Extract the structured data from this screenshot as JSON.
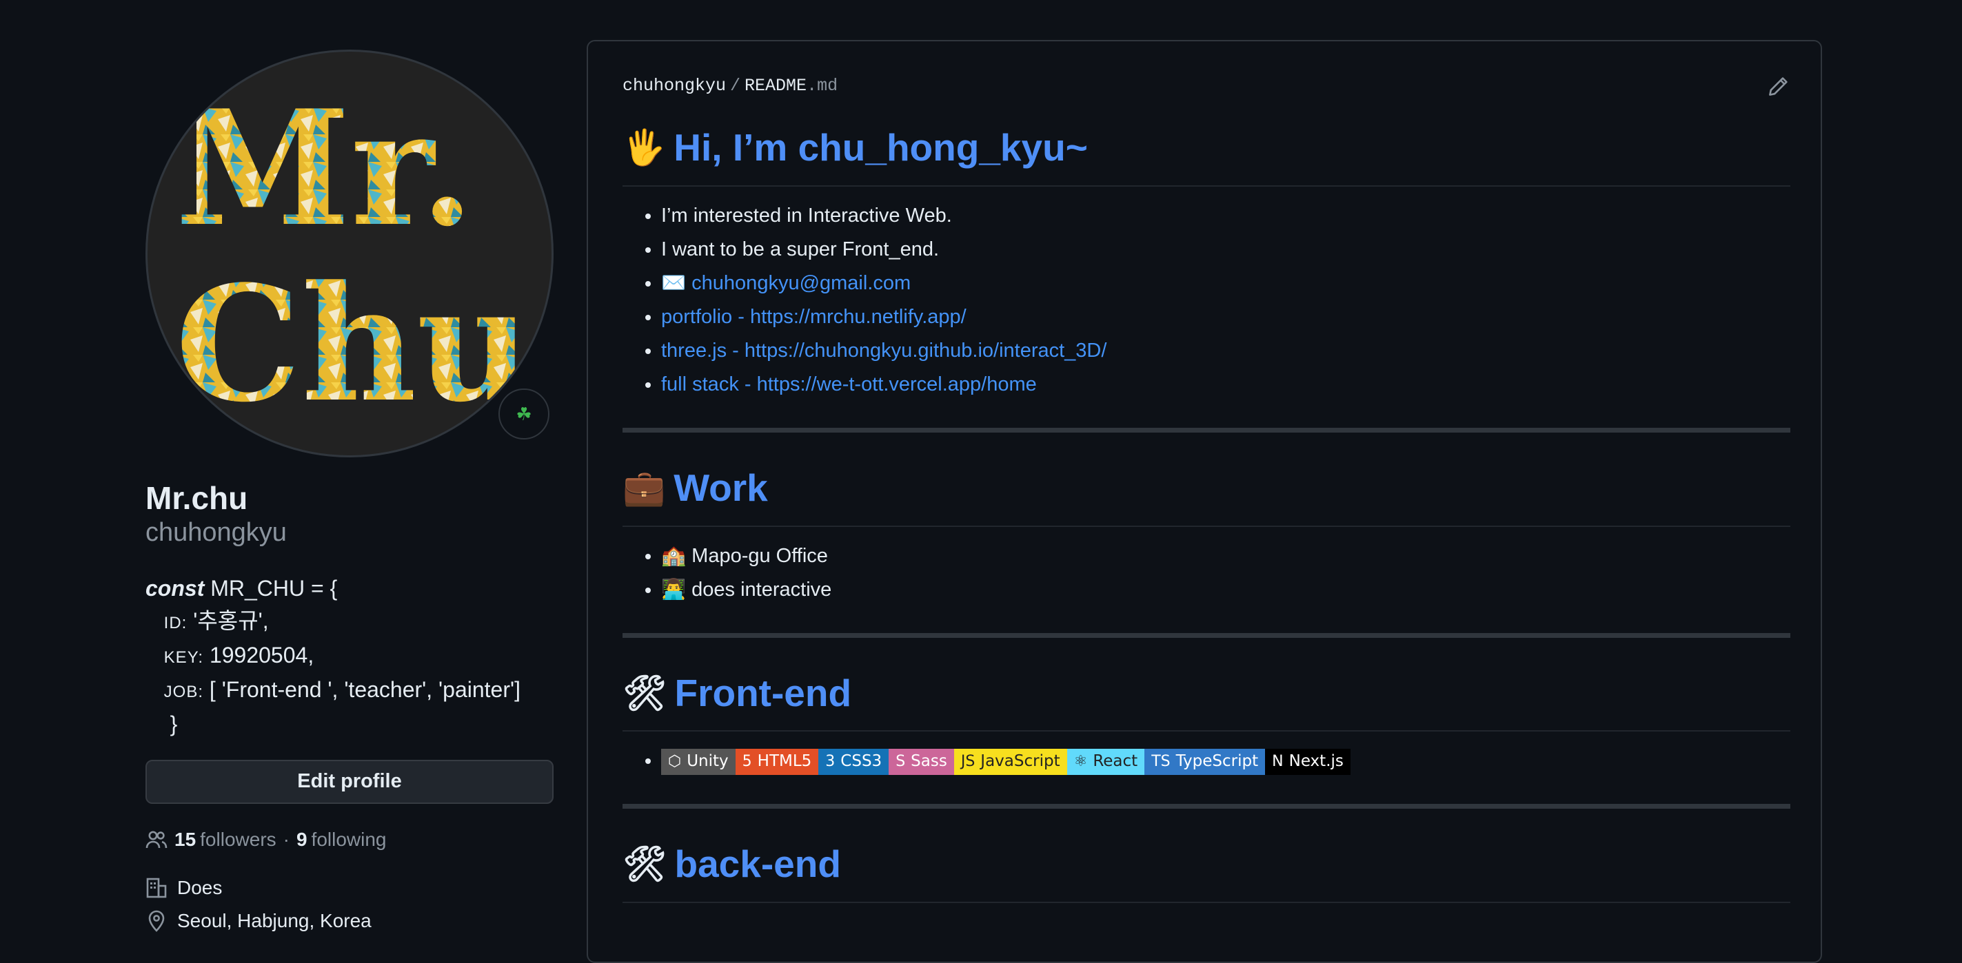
{
  "profile": {
    "display_name": "Mr.chu",
    "username": "chuhongkyu",
    "avatar_text_line1": "Mr.",
    "avatar_text_line2": "Chu",
    "status_emoji": "☘",
    "bio": {
      "const_kw": "const",
      "decl": " MR_CHU = {",
      "id_key": "ID:",
      "id_val": " '추홍규',",
      "key_key": "KEY:",
      "key_val": " 19920504,",
      "job_key": "JOB:",
      "job_val": " [ 'Front-end ', 'teacher', 'painter']",
      "close": "}"
    },
    "edit_button": "Edit profile",
    "followers_count": "15",
    "followers_label": "followers",
    "separator": "·",
    "following_count": "9",
    "following_label": "following",
    "company": "Does",
    "location": "Seoul, Habjung, Korea"
  },
  "readme": {
    "owner": "chuhongkyu",
    "slash": "/",
    "file_base": "README",
    "file_ext": ".md",
    "sections": {
      "intro": {
        "emoji": "🖐",
        "title": "Hi, I’m chu_hong_kyu~",
        "items": [
          "I’m interested in Interactive Web.",
          "I want to be a super Front_end."
        ],
        "email_emoji": "✉️",
        "email": "chuhongkyu@gmail.com",
        "links": [
          "portfolio - https://mrchu.netlify.app/",
          "three.js - https://chuhongkyu.github.io/interact_3D/",
          "full stack - https://we-t-ott.vercel.app/home"
        ]
      },
      "work": {
        "emoji": "💼",
        "title": "Work",
        "items": [
          {
            "emoji": "🏫",
            "text": "Mapo-gu Office"
          },
          {
            "emoji": "👨‍💻",
            "text": "does interactive"
          }
        ]
      },
      "frontend": {
        "emoji": "🛠",
        "title": "Front-end",
        "badges": [
          {
            "label": "Unity",
            "icon": "⬡",
            "color": "#555555"
          },
          {
            "label": "HTML5",
            "icon": "5",
            "color": "#e34f26"
          },
          {
            "label": "CSS3",
            "icon": "3",
            "color": "#1572b6"
          },
          {
            "label": "Sass",
            "icon": "S",
            "color": "#cc6699"
          },
          {
            "label": "JavaScript",
            "icon": "JS",
            "color": "#f7df1e"
          },
          {
            "label": "React",
            "icon": "⚛",
            "color": "#61dafb"
          },
          {
            "label": "TypeScript",
            "icon": "TS",
            "color": "#3178c6"
          },
          {
            "label": "Next.js",
            "icon": "N",
            "color": "#000000"
          }
        ]
      },
      "backend": {
        "emoji": "🛠",
        "title": "back-end"
      }
    }
  },
  "colors": {
    "background": "#0d1117",
    "link": "#4493f8",
    "text": "#e6edf3",
    "muted": "#8b949e",
    "border": "#30363d"
  }
}
